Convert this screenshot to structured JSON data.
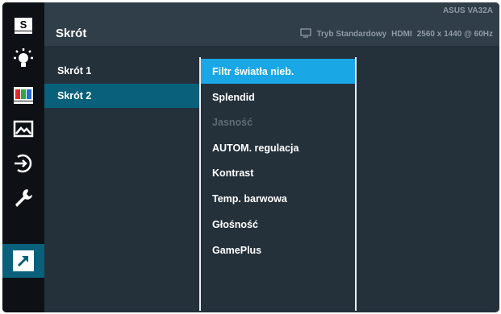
{
  "header": {
    "title": "Skrót",
    "model": "ASUS VA32A",
    "mode": "Tryb Standardowy",
    "input": "HDMI",
    "resolution": "2560 x 1440 @ 60Hz",
    "display_icon": "monitor-icon"
  },
  "sidebar": {
    "items": [
      {
        "icon": "splendid-s-icon",
        "active": false
      },
      {
        "icon": "blue-light-filter-icon",
        "active": false
      },
      {
        "icon": "color-bars-icon",
        "active": false
      },
      {
        "icon": "image-icon",
        "active": false
      },
      {
        "icon": "input-select-icon",
        "active": false
      },
      {
        "icon": "wrench-icon",
        "active": false
      },
      {
        "icon": "shortcut-arrow-icon",
        "active": true
      }
    ]
  },
  "shortcuts": {
    "items": [
      {
        "label": "Skrót 1",
        "selected": false
      },
      {
        "label": "Skrót 2",
        "selected": true
      }
    ]
  },
  "options": {
    "items": [
      {
        "label": "Filtr światła nieb.",
        "state": "highlighted"
      },
      {
        "label": "Splendid",
        "state": "normal"
      },
      {
        "label": "Jasność",
        "state": "disabled"
      },
      {
        "label": "AUTOM. regulacja",
        "state": "normal"
      },
      {
        "label": "Kontrast",
        "state": "normal"
      },
      {
        "label": "Temp. barwowa",
        "state": "normal"
      },
      {
        "label": "Głośność",
        "state": "normal"
      },
      {
        "label": "GamePlus",
        "state": "normal"
      }
    ]
  },
  "colors": {
    "background": "#24313b",
    "rail": "#0d1115",
    "active_teal": "#08607a",
    "highlight_blue": "#1aa7e6",
    "disabled_text": "#5f6b74"
  }
}
